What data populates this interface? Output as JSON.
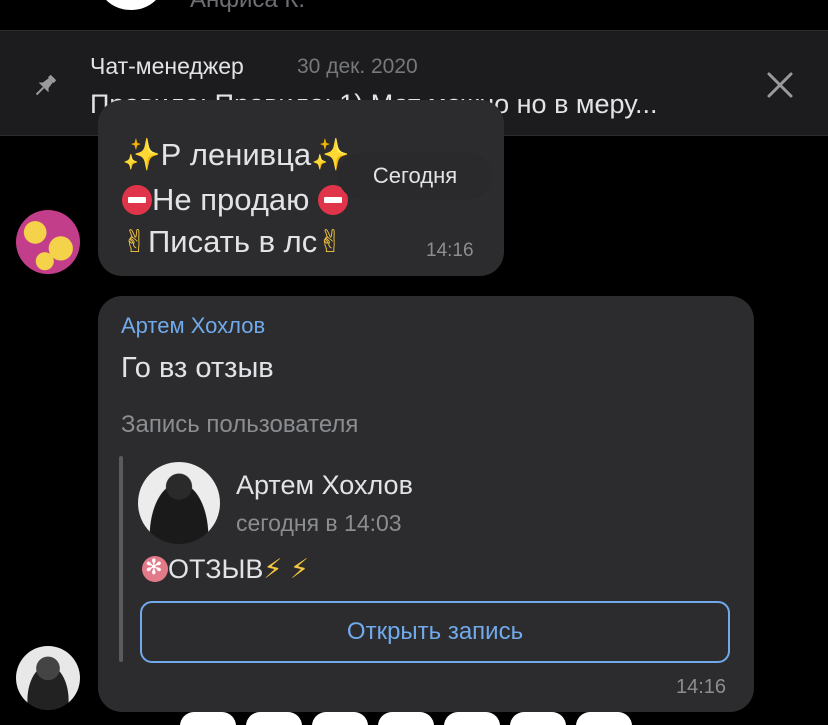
{
  "top": {
    "name": "Анфиса К."
  },
  "pinned": {
    "author": "Чат-менеджер",
    "date": "30 дек. 2020",
    "text": "Правила: Правила: 1) Мат можно но в меру..."
  },
  "bubble1": {
    "line1": "Р ленивца",
    "line2": "Не продаю",
    "line3": "Писать в лс",
    "time": "14:16"
  },
  "date_chip": "Сегодня",
  "bubble2": {
    "author": "Артем Хохлов",
    "text": "Го вз отзыв",
    "attachment_label": "Запись пользователя",
    "post": {
      "author": "Артем Хохлов",
      "date": "сегодня в 14:03",
      "text": "ОТЗЫВ"
    },
    "open_button": "Открыть запись",
    "time": "14:16"
  },
  "icons": {
    "pin": "pin-icon",
    "close": "close-icon"
  },
  "colors": {
    "accent": "#71aaeb",
    "bubble": "#2c2c2e",
    "background": "#000000"
  }
}
